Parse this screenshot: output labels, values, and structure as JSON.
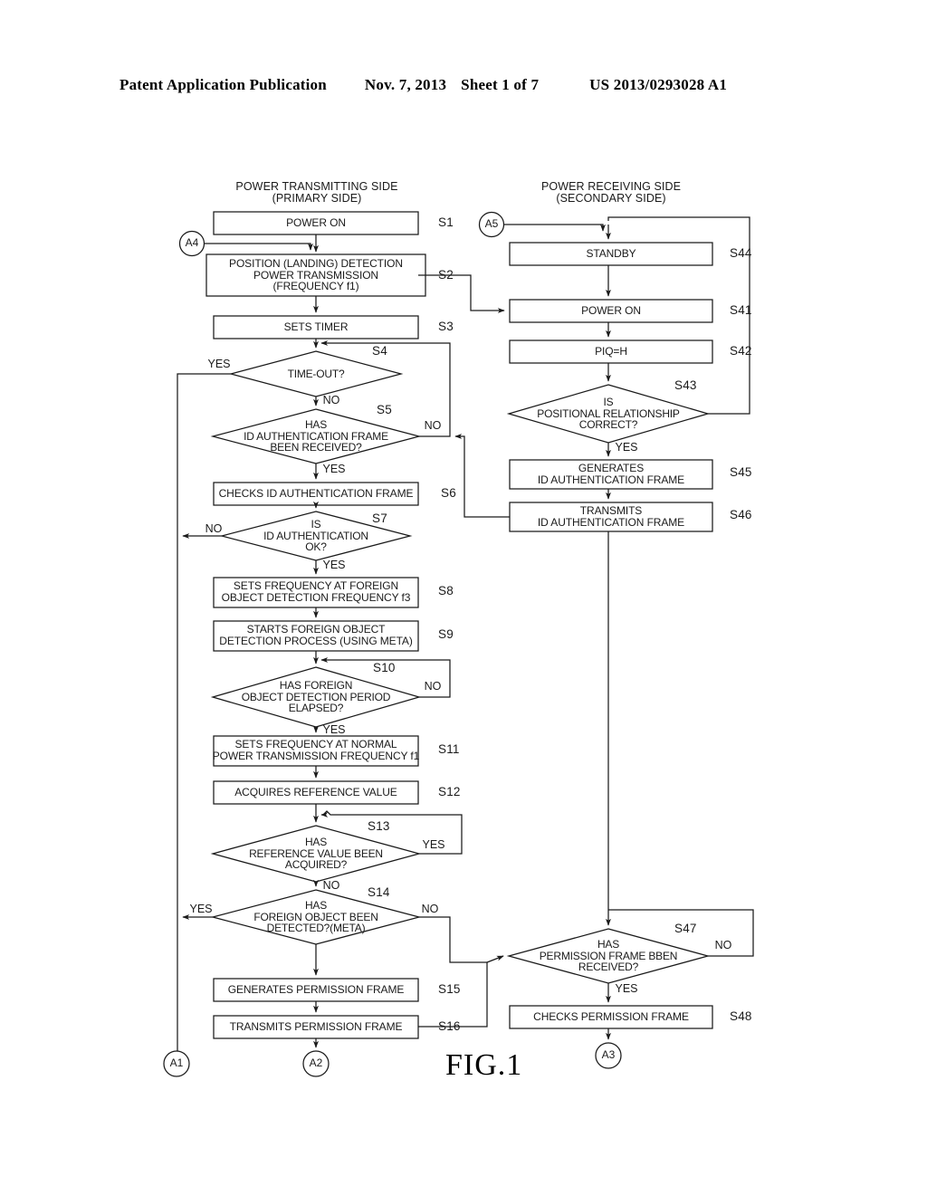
{
  "header": {
    "publication": "Patent Application Publication",
    "date": "Nov. 7, 2013",
    "sheet": "Sheet 1 of 7",
    "number": "US 2013/0293028 A1"
  },
  "figure": {
    "label": "FIG.1",
    "columns": [
      {
        "id": "primary",
        "title": "POWER TRANSMITTING SIDE\n(PRIMARY SIDE)"
      },
      {
        "id": "secondary",
        "title": "POWER RECEIVING SIDE\n(SECONDARY SIDE)"
      }
    ],
    "left_nodes": [
      {
        "id": "S1",
        "shape": "process",
        "step": "S1",
        "text": "POWER ON"
      },
      {
        "id": "S2",
        "shape": "process",
        "step": "S2",
        "text": "POSITION (LANDING) DETECTION\nPOWER TRANSMISSION\n(FREQUENCY f1)"
      },
      {
        "id": "S3",
        "shape": "process",
        "step": "S3",
        "text": "SETS TIMER"
      },
      {
        "id": "S4",
        "shape": "decision",
        "step": "S4",
        "text": "TIME-OUT?"
      },
      {
        "id": "S5",
        "shape": "decision",
        "step": "S5",
        "text": "HAS\nID AUTHENTICATION FRAME\nBEEN RECEIVED?"
      },
      {
        "id": "S6",
        "shape": "process",
        "step": "S6",
        "text": "CHECKS ID AUTHENTICATION FRAME"
      },
      {
        "id": "S7",
        "shape": "decision",
        "step": "S7",
        "text": "IS\nID AUTHENTICATION\nOK?"
      },
      {
        "id": "S8",
        "shape": "process",
        "step": "S8",
        "text": "SETS FREQUENCY AT FOREIGN\nOBJECT DETECTION FREQUENCY f3"
      },
      {
        "id": "S9",
        "shape": "process",
        "step": "S9",
        "text": "STARTS FOREIGN OBJECT\nDETECTION PROCESS (USING META)"
      },
      {
        "id": "S10",
        "shape": "decision",
        "step": "S10",
        "text": "HAS FOREIGN\nOBJECT DETECTION PERIOD\nELAPSED?"
      },
      {
        "id": "S11",
        "shape": "process",
        "step": "S11",
        "text": "SETS FREQUENCY AT NORMAL\nPOWER TRANSMISSION FREQUENCY f1"
      },
      {
        "id": "S12",
        "shape": "process",
        "step": "S12",
        "text": "ACQUIRES REFERENCE VALUE"
      },
      {
        "id": "S13",
        "shape": "decision",
        "step": "S13",
        "text": "HAS\nREFERENCE VALUE BEEN\nACQUIRED?"
      },
      {
        "id": "S14",
        "shape": "decision",
        "step": "S14",
        "text": "HAS\nFOREIGN OBJECT BEEN\nDETECTED?(META)"
      },
      {
        "id": "S15",
        "shape": "process",
        "step": "S15",
        "text": "GENERATES PERMISSION FRAME"
      },
      {
        "id": "S16",
        "shape": "process",
        "step": "S16",
        "text": "TRANSMITS PERMISSION FRAME"
      }
    ],
    "right_nodes": [
      {
        "id": "S44",
        "shape": "process",
        "step": "S44",
        "text": "STANDBY"
      },
      {
        "id": "S41",
        "shape": "process",
        "step": "S41",
        "text": "POWER ON"
      },
      {
        "id": "S42",
        "shape": "process",
        "step": "S42",
        "text": "PIQ=H"
      },
      {
        "id": "S43",
        "shape": "decision",
        "step": "S43",
        "text": "IS\nPOSITIONAL RELATIONSHIP\nCORRECT?"
      },
      {
        "id": "S45",
        "shape": "process",
        "step": "S45",
        "text": "GENERATES\nID AUTHENTICATION FRAME"
      },
      {
        "id": "S46",
        "shape": "process",
        "step": "S46",
        "text": "TRANSMITS\nID AUTHENTICATION FRAME"
      },
      {
        "id": "S47",
        "shape": "decision",
        "step": "S47",
        "text": "HAS\nPERMISSION FRAME BBEN\nRECEIVED?"
      },
      {
        "id": "S48",
        "shape": "process",
        "step": "S48",
        "text": "CHECKS PERMISSION FRAME"
      }
    ],
    "connectors": [
      {
        "id": "A4",
        "text": "A4"
      },
      {
        "id": "A5",
        "text": "A5"
      },
      {
        "id": "A1",
        "text": "A1"
      },
      {
        "id": "A2",
        "text": "A2"
      },
      {
        "id": "A3",
        "text": "A3"
      }
    ],
    "branch_labels": [
      {
        "id": "s4-yes",
        "text": "YES"
      },
      {
        "id": "s4-no",
        "text": "NO"
      },
      {
        "id": "s5-no",
        "text": "NO"
      },
      {
        "id": "s5-yes",
        "text": "YES"
      },
      {
        "id": "s7-no",
        "text": "NO"
      },
      {
        "id": "s7-yes",
        "text": "YES"
      },
      {
        "id": "s10-no",
        "text": "NO"
      },
      {
        "id": "s10-yes",
        "text": "YES"
      },
      {
        "id": "s13-yes",
        "text": "YES"
      },
      {
        "id": "s13-no",
        "text": "NO"
      },
      {
        "id": "s14-yes",
        "text": "YES"
      },
      {
        "id": "s14-no",
        "text": "NO"
      },
      {
        "id": "s43-yes",
        "text": "YES"
      },
      {
        "id": "s47-no",
        "text": "NO"
      },
      {
        "id": "s47-yes",
        "text": "YES"
      }
    ]
  },
  "colors": {
    "ink": "#1a1a1a",
    "paper": "#ffffff"
  }
}
